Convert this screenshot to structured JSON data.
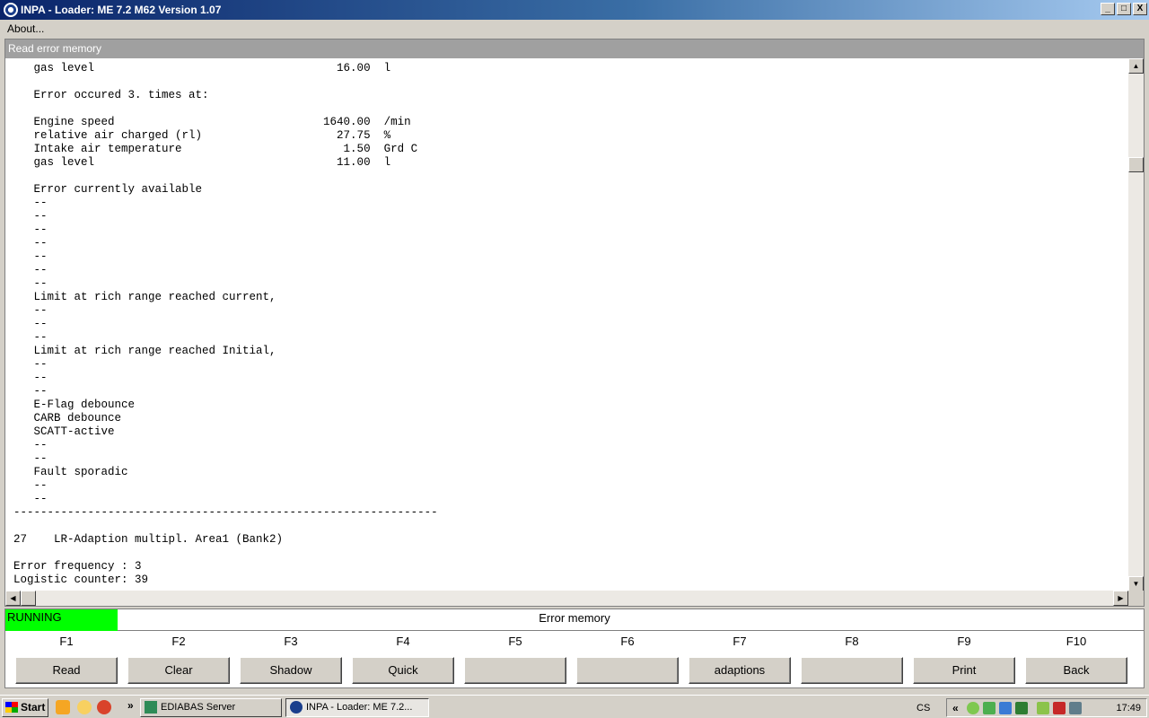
{
  "window": {
    "title": "INPA - Loader: ME 7.2 M62 Version 1.07",
    "minimize": "_",
    "maximize": "□",
    "close": "X"
  },
  "menu": {
    "about": "About..."
  },
  "panel": {
    "header": "Read error memory"
  },
  "output_lines": [
    "   gas level                                    16.00  l",
    "",
    "   Error occured 3. times at:",
    "",
    "   Engine speed                               1640.00  /min",
    "   relative air charged (rl)                    27.75  %",
    "   Intake air temperature                        1.50  Grd C",
    "   gas level                                    11.00  l",
    "",
    "   Error currently available",
    "   --",
    "   --",
    "   --",
    "   --",
    "   --",
    "   --",
    "   --",
    "   Limit at rich range reached current,",
    "   --",
    "   --",
    "   --",
    "   Limit at rich range reached Initial,",
    "   --",
    "   --",
    "   --",
    "   E-Flag debounce",
    "   CARB debounce",
    "   SCATT-active",
    "   --",
    "   --",
    "   Fault sporadic",
    "   --",
    "   --",
    "---------------------------------------------------------------",
    "",
    "27    LR-Adaption multipl. Area1 (Bank2)",
    "",
    "Error frequency : 3",
    "Logistic counter: 39"
  ],
  "status": {
    "state": "RUNNING",
    "state_color": "#00ff00",
    "title": "Error memory"
  },
  "fkeys": [
    {
      "key": "F1",
      "label": "Read"
    },
    {
      "key": "F2",
      "label": "Clear"
    },
    {
      "key": "F3",
      "label": "Shadow"
    },
    {
      "key": "F4",
      "label": "Quick"
    },
    {
      "key": "F5",
      "label": ""
    },
    {
      "key": "F6",
      "label": ""
    },
    {
      "key": "F7",
      "label": "adaptions"
    },
    {
      "key": "F8",
      "label": ""
    },
    {
      "key": "F9",
      "label": "Print"
    },
    {
      "key": "F10",
      "label": "Back"
    }
  ],
  "taskbar": {
    "start": "Start",
    "chevron": "»",
    "tasks": [
      {
        "label": "EDIABAS Server",
        "active": false
      },
      {
        "label": "INPA - Loader:  ME 7.2...",
        "active": true
      }
    ],
    "language": "CS",
    "tray_chevron": "«",
    "clock": "17:49"
  }
}
